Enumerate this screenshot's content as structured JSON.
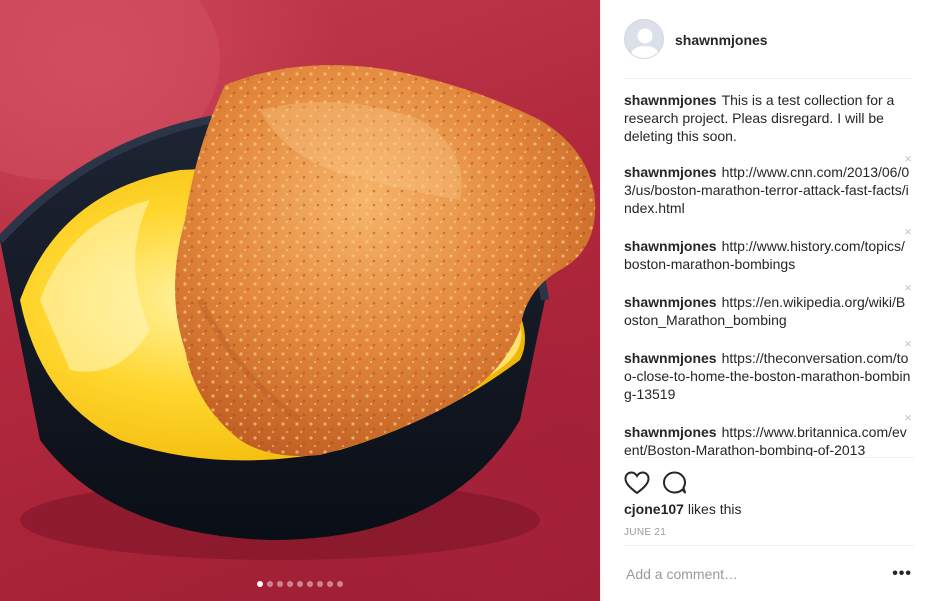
{
  "post": {
    "username": "shawnmjones",
    "carousel": {
      "count": 9,
      "active_index": 0
    }
  },
  "comments": [
    {
      "user": "shawnmjones",
      "text": "This is a test collection for a research project. Pleas disregard. I will be deleting this soon.",
      "deletable": false
    },
    {
      "user": "shawnmjones",
      "text": "http://www.cnn.com/2013/06/03/us/boston-marathon-terror-attack-fast-facts/index.html",
      "deletable": true
    },
    {
      "user": "shawnmjones",
      "text": "http://www.history.com/topics/boston-marathon-bombings",
      "deletable": true
    },
    {
      "user": "shawnmjones",
      "text": "https://en.wikipedia.org/wiki/Boston_Marathon_bombing",
      "deletable": true
    },
    {
      "user": "shawnmjones",
      "text": "https://theconversation.com/too-close-to-home-the-boston-marathon-bombing-13519",
      "deletable": true
    },
    {
      "user": "shawnmjones",
      "text": "https://www.britannica.com/event/Boston-Marathon-bombing-of-2013",
      "deletable": true
    }
  ],
  "close_glyph": "×",
  "likes": {
    "user": "cjone107",
    "suffix": "likes this"
  },
  "date": "JUNE 21",
  "add_comment": {
    "placeholder": "Add a comment…"
  },
  "more_glyph": "•••",
  "icons": {
    "like": "heart-icon",
    "comment": "comment-bubble-icon",
    "delete": "close-icon",
    "options": "more-options-icon"
  },
  "colors": {
    "background_red": "#b1283d",
    "text": "#262626",
    "muted": "#999999",
    "divider": "#efefef"
  }
}
